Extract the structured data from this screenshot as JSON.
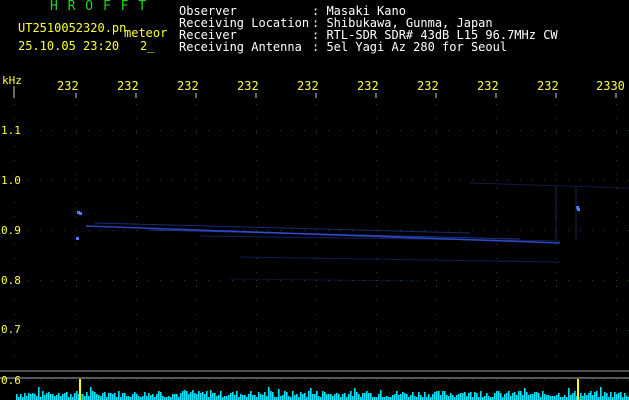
{
  "header": {
    "app_title": "H R O F F T",
    "file_name": "UT2510052320.pn",
    "meteor_label": "meteor",
    "date_time": "25.10.05 23:20",
    "count": "2_"
  },
  "info": [
    {
      "key": "Observer",
      "value": ": Masaki Kano"
    },
    {
      "key": "Receiving Location",
      "value": ": Shibukawa, Gunma, Japan"
    },
    {
      "key": "Receiver",
      "value": ": RTL-SDR SDR# 43dB L15 96.7MHz CW"
    },
    {
      "key": "Receiving Antenna",
      "value": ": 5el Yagi Az 280 for Seoul"
    }
  ],
  "axis": {
    "y_unit": "kHz",
    "x_ticks": [
      "232",
      "232",
      "232",
      "232",
      "232",
      "232",
      "232",
      "232",
      "232",
      "2330"
    ],
    "y_ticks": [
      "1.1",
      "1.0",
      "0.9",
      "0.8",
      "0.7",
      "0.6"
    ]
  },
  "colors": {
    "header_green": "#22d322",
    "label_yellow": "#ffff3a",
    "info_white": "#ffffff",
    "grid_dots": "#1e4a1e",
    "signal_blue": "#3a5cff",
    "power_cyan": "#00e5ff",
    "marker_yellow": "#ffff00"
  }
}
